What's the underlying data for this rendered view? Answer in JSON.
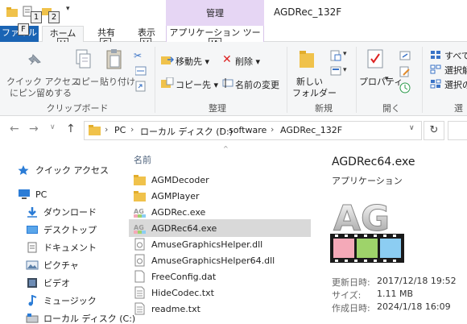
{
  "window": {
    "title": "AGDRec_132F",
    "context_group": "管理"
  },
  "quick_access_toolbar": {
    "keytips": [
      "1",
      "2"
    ]
  },
  "tabs": [
    {
      "label": "ファイル",
      "keytip": "F"
    },
    {
      "label": "ホーム",
      "keytip": "H"
    },
    {
      "label": "共有",
      "keytip": "S"
    },
    {
      "label": "表示",
      "keytip": "V"
    },
    {
      "label": "アプリケーション ツール",
      "keytip": "JA"
    }
  ],
  "ribbon": {
    "clipboard": {
      "group_label": "クリップボード",
      "pin_line1": "クイック アクセス",
      "pin_line2": "にピン留めする",
      "copy": "コピー",
      "paste": "貼り付け"
    },
    "organize": {
      "group_label": "整理",
      "move_to": "移動先",
      "copy_to": "コピー先",
      "delete": "削除",
      "rename": "名前の変更"
    },
    "new": {
      "group_label": "新規",
      "new_folder_line1": "新しい",
      "new_folder_line2": "フォルダー"
    },
    "open": {
      "group_label": "開く",
      "properties": "プロパティ"
    },
    "select": {
      "group_label": "選",
      "items": [
        "すべて",
        "選択解",
        "選択の"
      ]
    }
  },
  "address": {
    "crumbs": [
      "PC",
      "ローカル ディスク (D:)",
      "software",
      "AGDRec_132F"
    ]
  },
  "nav_pane": {
    "items": [
      {
        "label": "クイック アクセス",
        "icon": "star-icon"
      },
      {
        "label": "PC",
        "icon": "pc-icon"
      },
      {
        "label": "ダウンロード",
        "icon": "download-icon"
      },
      {
        "label": "デスクトップ",
        "icon": "desktop-icon"
      },
      {
        "label": "ドキュメント",
        "icon": "document-icon"
      },
      {
        "label": "ピクチャ",
        "icon": "picture-icon"
      },
      {
        "label": "ビデオ",
        "icon": "video-icon"
      },
      {
        "label": "ミュージック",
        "icon": "music-icon"
      },
      {
        "label": "ローカル ディスク (C:)",
        "icon": "drive-icon"
      }
    ]
  },
  "file_list": {
    "column_name": "名前",
    "files": [
      {
        "name": "AGMDecoder",
        "icon": "folder-icon"
      },
      {
        "name": "AGMPlayer",
        "icon": "folder-icon"
      },
      {
        "name": "AGDRec.exe",
        "icon": "app-icon"
      },
      {
        "name": "AGDRec64.exe",
        "icon": "app-icon",
        "selected": true
      },
      {
        "name": "AmuseGraphicsHelper.dll",
        "icon": "dll-icon"
      },
      {
        "name": "AmuseGraphicsHelper64.dll",
        "icon": "dll-icon"
      },
      {
        "name": "FreeConfig.dat",
        "icon": "file-icon"
      },
      {
        "name": "HideCodec.txt",
        "icon": "text-icon"
      },
      {
        "name": "readme.txt",
        "icon": "text-icon"
      }
    ]
  },
  "details": {
    "name": "AGDRec64.exe",
    "type": "アプリケーション",
    "logo_text": "AG",
    "modified_label": "更新日時:",
    "modified_value": "2017/12/18 19:52",
    "size_label": "サイズ:",
    "size_value": "1.11 MB",
    "created_label": "作成日時:",
    "created_value": "2024/1/18 16:09"
  },
  "colors": {
    "file_tab": "#1a64b4",
    "context_band": "#e6d6f4",
    "selection": "#d9d9d9",
    "folder": "#f0c24b",
    "logo_pink": "#f4a9b8",
    "logo_green": "#9ed36a",
    "logo_blue": "#8ccdf2"
  }
}
